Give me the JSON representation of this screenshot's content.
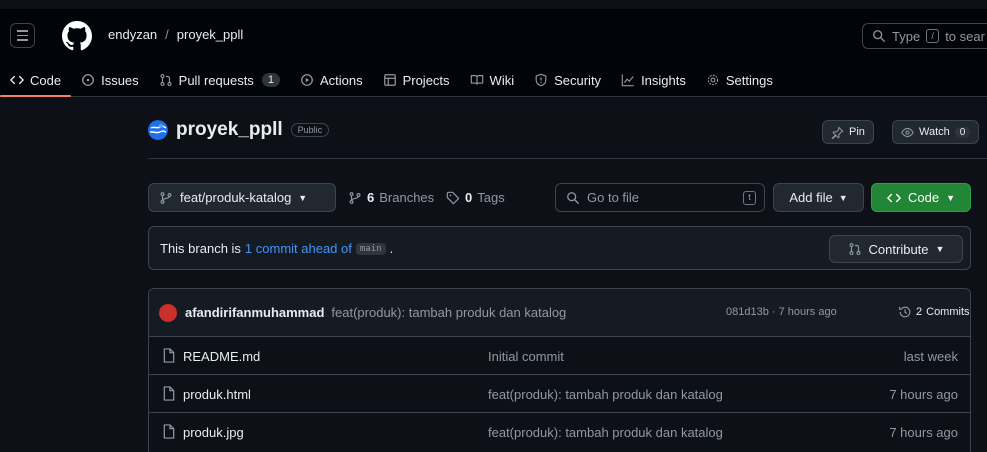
{
  "header": {
    "owner": "endyzan",
    "separator": "/",
    "repo": "proyek_ppll",
    "search_placeholder": "Type",
    "search_key": "/",
    "search_suffix": "to sear"
  },
  "tabs": [
    {
      "label": "Code",
      "icon": "code-icon",
      "active": true
    },
    {
      "label": "Issues",
      "icon": "issue-icon"
    },
    {
      "label": "Pull requests",
      "icon": "pull-request-icon",
      "count": "1"
    },
    {
      "label": "Actions",
      "icon": "play-icon"
    },
    {
      "label": "Projects",
      "icon": "table-icon"
    },
    {
      "label": "Wiki",
      "icon": "book-icon"
    },
    {
      "label": "Security",
      "icon": "shield-icon"
    },
    {
      "label": "Insights",
      "icon": "graph-icon"
    },
    {
      "label": "Settings",
      "icon": "gear-icon"
    }
  ],
  "repo": {
    "name": "proyek_ppll",
    "visibility": "Public",
    "pin_label": "Pin",
    "watch_label": "Watch",
    "watch_count": "0"
  },
  "toolbar": {
    "branch": "feat/produk-katalog",
    "branches_count": "6",
    "branches_label": "Branches",
    "tags_count": "0",
    "tags_label": "Tags",
    "goto_placeholder": "Go to file",
    "goto_key": "t",
    "add_file_label": "Add file",
    "code_label": "Code"
  },
  "ahead": {
    "prefix": "This branch is",
    "link": "1 commit ahead of",
    "base": "main",
    "suffix": ".",
    "contribute_label": "Contribute"
  },
  "latest_commit": {
    "author": "afandirifanmuhammad",
    "message": "feat(produk): tambah produk dan katalog",
    "hash_time": "081d13b · 7 hours ago",
    "commits_count": "2",
    "commits_label": "Commits"
  },
  "files": [
    {
      "name": "README.md",
      "message": "Initial commit",
      "date": "last week"
    },
    {
      "name": "produk.html",
      "message": "feat(produk): tambah produk dan katalog",
      "date": "7 hours ago"
    },
    {
      "name": "produk.jpg",
      "message": "feat(produk): tambah produk dan katalog",
      "date": "7 hours ago"
    }
  ],
  "colors": {
    "background": "#0d1117",
    "header": "#010409",
    "accent_tab": "#f78166",
    "link": "#4493f8",
    "primary_button": "#238636"
  }
}
